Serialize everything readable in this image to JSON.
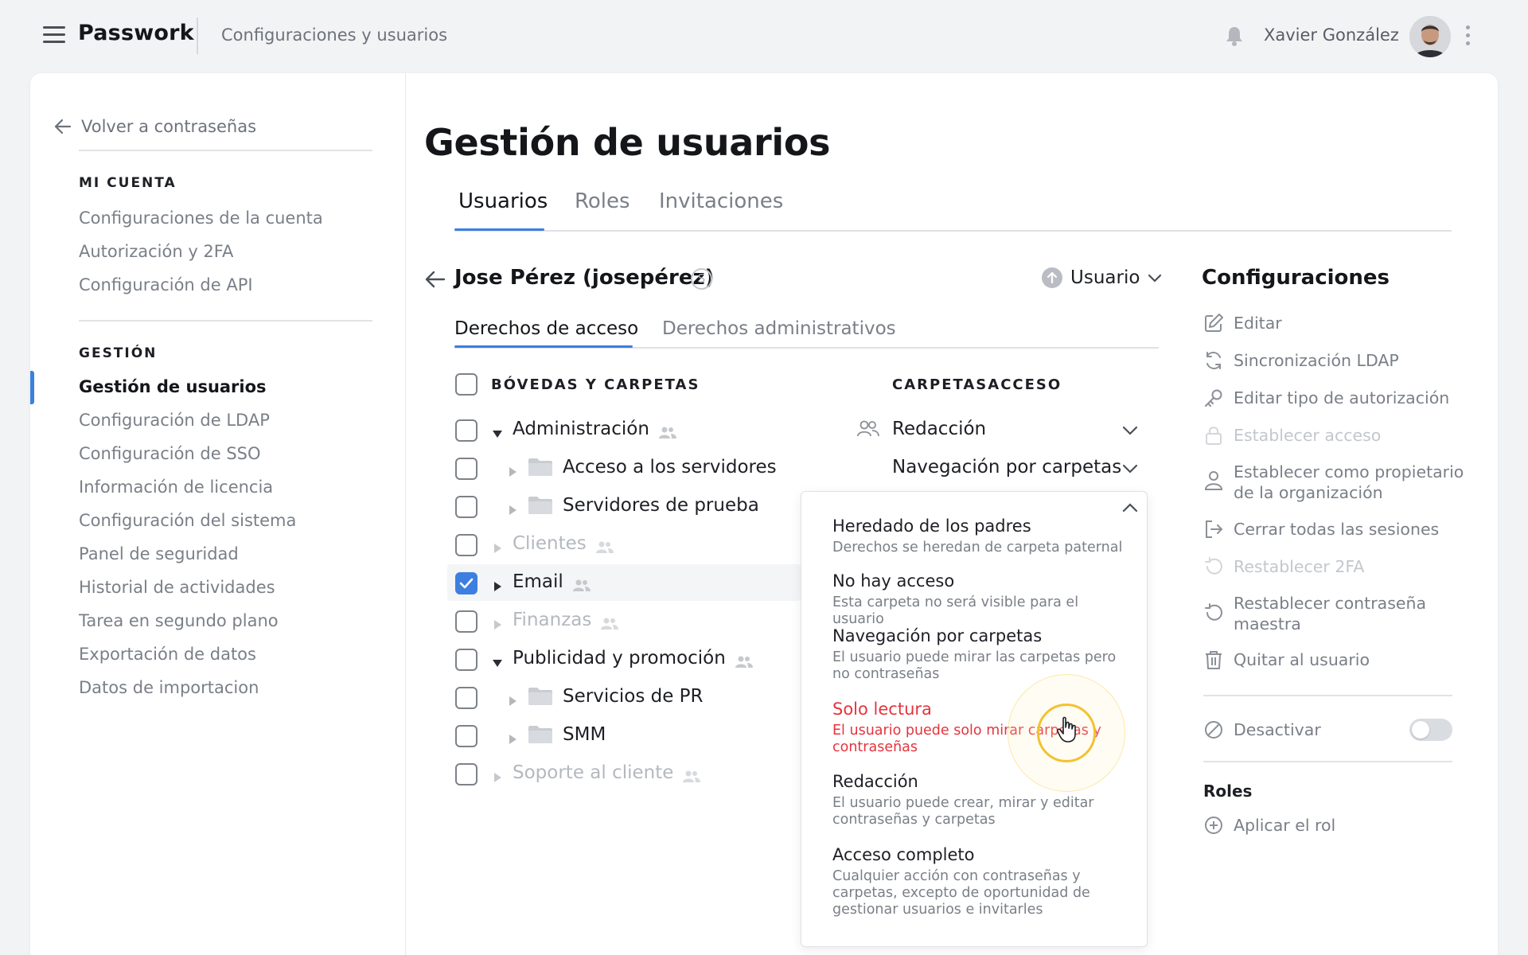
{
  "app": {
    "name": "Passwork",
    "breadcrumb": "Configuraciones y usuarios"
  },
  "header": {
    "user_name": "Xavier González"
  },
  "sidebar": {
    "back": "Volver a contraseñas",
    "section1": "MI CUENTA",
    "account_items": [
      "Configuraciones de la cuenta",
      "Autorización y 2FA",
      "Configuración de API"
    ],
    "section2": "GESTIÓN",
    "manage_items": [
      "Gestión de usuarios",
      "Configuración de LDAP",
      "Configuración de SSO",
      "Información de licencia",
      "Configuración del sistema",
      "Panel de seguridad",
      "Historial de actividades",
      "Tarea en segundo plano",
      "Exportación de datos",
      "Datos de importacion"
    ],
    "active_item": "Gestión de usuarios"
  },
  "main": {
    "title": "Gestión de usuarios",
    "tabs": [
      "Usuarios",
      "Roles",
      "Invitaciones"
    ],
    "active_tab": "Usuarios",
    "user": {
      "name": "Jose Pérez (josepérez)",
      "badge": "S",
      "role": "Usuario"
    },
    "subtabs": [
      "Derechos de acceso",
      "Derechos administrativos"
    ],
    "active_subtab": "Derechos de acceso",
    "columns": {
      "vaults": "BÓVEDAS Y CARPETAS",
      "access": "CARPETASACCESO"
    },
    "tree": [
      {
        "label": "Administración",
        "level": 0,
        "expanded": true,
        "muted": false,
        "checked": false,
        "shared": true
      },
      {
        "label": "Acceso a los servidores",
        "level": 1,
        "folder": true,
        "muted": false,
        "checked": false
      },
      {
        "label": "Servidores de prueba",
        "level": 1,
        "folder": true,
        "muted": false,
        "checked": false
      },
      {
        "label": "Clientes",
        "level": 0,
        "muted": true,
        "checked": false,
        "shared": true
      },
      {
        "label": "Email",
        "level": 0,
        "muted": false,
        "checked": true,
        "shared": true
      },
      {
        "label": "Finanzas",
        "level": 0,
        "muted": true,
        "checked": false,
        "shared": true
      },
      {
        "label": "Publicidad y promoción",
        "level": 0,
        "expanded": true,
        "muted": false,
        "checked": false,
        "shared": true
      },
      {
        "label": "Servicios de PR",
        "level": 1,
        "folder": true,
        "muted": false,
        "checked": false
      },
      {
        "label": "SMM",
        "level": 1,
        "folder": true,
        "muted": false,
        "checked": false
      },
      {
        "label": "Soporte al cliente",
        "level": 0,
        "muted": true,
        "checked": false,
        "shared": true
      }
    ],
    "permissions": [
      "Redacción",
      "Navegación por carpetas"
    ],
    "dropdown": [
      {
        "title": "Heredado de los padres",
        "desc": "Derechos se heredan de carpeta paternal"
      },
      {
        "title": "No hay acceso",
        "desc": "Esta carpeta no será visible para el usuario"
      },
      {
        "title": "Navegación por carpetas",
        "desc": "El usuario puede mirar las carpetas pero no contraseñas"
      },
      {
        "title": "Solo lectura",
        "desc": "El usuario puede solo mirar carpetas y contraseñas",
        "highlighted": true
      },
      {
        "title": "Redacción",
        "desc": "El usuario puede crear, mirar y editar contraseñas y carpetas"
      },
      {
        "title": "Acceso completo",
        "desc": "Cualquier acción con contraseñas y carpetas, excepto de oportunidad de gestionar usuarios e invitarles"
      }
    ]
  },
  "settings": {
    "title": "Configuraciones",
    "items": [
      {
        "label": "Editar",
        "icon": "edit-icon",
        "disabled": false
      },
      {
        "label": "Sincronización LDAP",
        "icon": "sync-icon",
        "disabled": false
      },
      {
        "label": "Editar tipo de autorización",
        "icon": "key-icon",
        "disabled": false
      },
      {
        "label": "Establecer acceso",
        "icon": "lock-icon",
        "disabled": true
      },
      {
        "label": "Establecer como propietario de la organización",
        "icon": "user-icon",
        "disabled": false
      },
      {
        "label": "Cerrar todas las sesiones",
        "icon": "logout-icon",
        "disabled": false
      },
      {
        "label": "Restablecer 2FA",
        "icon": "reset-icon",
        "disabled": true
      },
      {
        "label": "Restablecer contraseña maestra",
        "icon": "reset-icon",
        "disabled": false
      },
      {
        "label": "Quitar al usuario",
        "icon": "trash-icon",
        "disabled": false
      }
    ],
    "deactivate": "Desactivar",
    "deactivate_on": false,
    "roles_title": "Roles",
    "apply_role": "Aplicar el rol"
  },
  "colors": {
    "accent": "#3c7fe0",
    "danger": "#e5343d",
    "highlight_ring": "#f2c230"
  }
}
